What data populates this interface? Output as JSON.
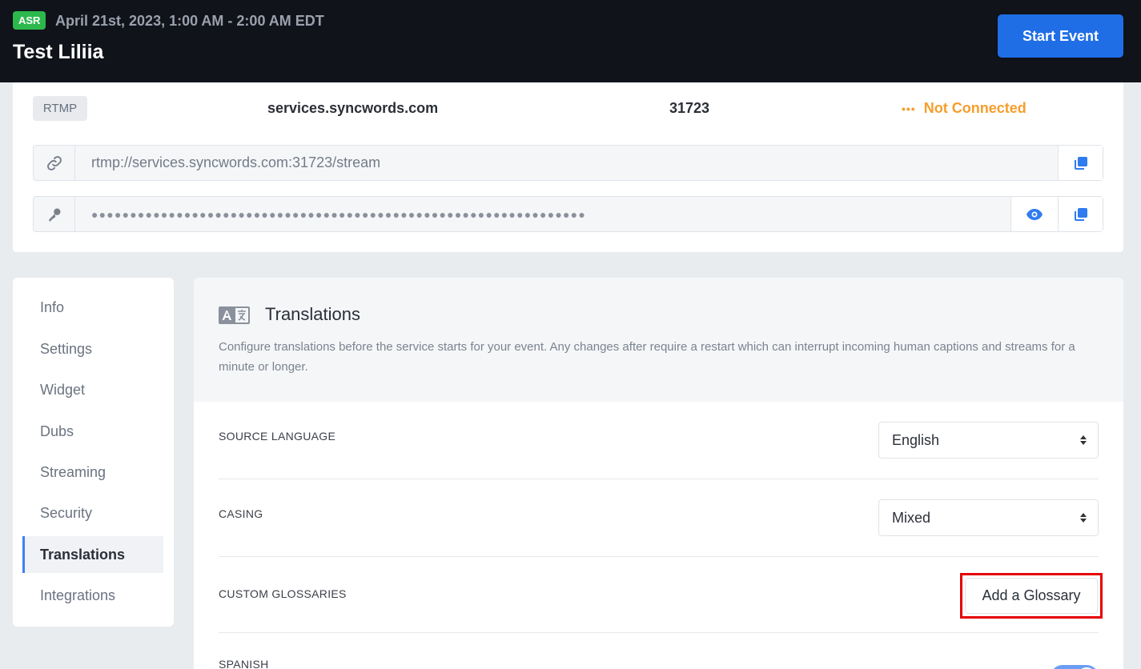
{
  "header": {
    "badge": "ASR",
    "date": "April 21st, 2023, 1:00 AM - 2:00 AM EDT",
    "title": "Test Liliia",
    "start_button": "Start Event"
  },
  "rtmp": {
    "tag": "RTMP",
    "host": "services.syncwords.com",
    "port": "31723",
    "status_dots": "•••",
    "status": "Not Connected",
    "url": "rtmp://services.syncwords.com:31723/stream",
    "key_masked": "●●●●●●●●●●●●●●●●●●●●●●●●●●●●●●●●●●●●●●●●●●●●●●●●●●●●●●●●●●●●●●●●"
  },
  "sidebar": {
    "items": [
      {
        "label": "Info"
      },
      {
        "label": "Settings"
      },
      {
        "label": "Widget"
      },
      {
        "label": "Dubs"
      },
      {
        "label": "Streaming"
      },
      {
        "label": "Security"
      },
      {
        "label": "Translations",
        "active": true
      },
      {
        "label": "Integrations"
      }
    ]
  },
  "translations": {
    "title": "Translations",
    "description": "Configure translations before the service starts for your event. Any changes after require a restart which can interrupt incoming human captions and streams for a minute or longer.",
    "source_language_label": "SOURCE LANGUAGE",
    "source_language_value": "English",
    "casing_label": "CASING",
    "casing_value": "Mixed",
    "glossaries_label": "CUSTOM GLOSSARIES",
    "glossary_button": "Add a Glossary",
    "spanish_label": "SPANISH"
  },
  "colors": {
    "accent": "#1f6ee6",
    "badge_green": "#2db84d",
    "status_orange": "#f59e2b",
    "highlight_red": "#e60000"
  },
  "icons": [
    "link-icon",
    "key-icon",
    "copy-icon",
    "eye-icon",
    "translate-icon",
    "select-caret-icon"
  ]
}
